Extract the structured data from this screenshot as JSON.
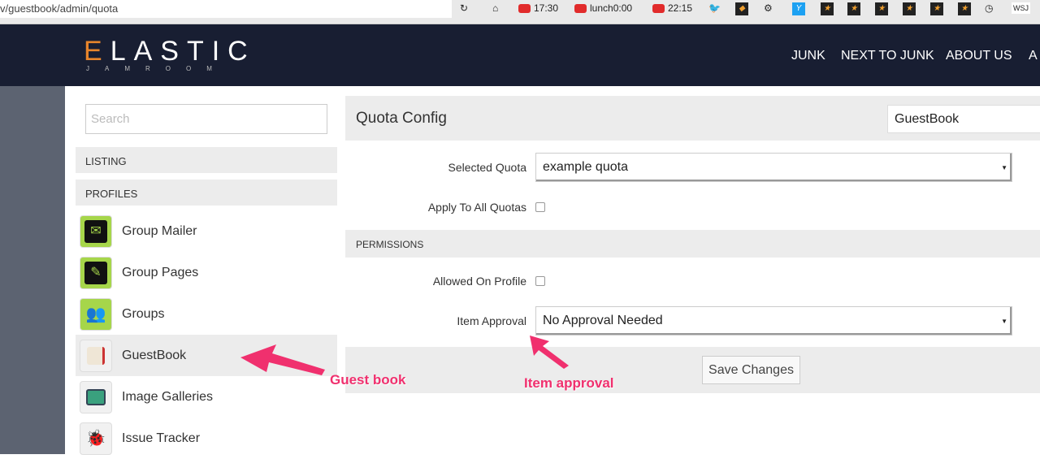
{
  "browser": {
    "url": "v/guestbook/admin/quota",
    "bookmarks": [
      "17:30",
      "lunch0:00",
      "22:15"
    ],
    "wsj": "WSJ"
  },
  "header": {
    "logo_first": "E",
    "logo_rest": "LASTIC",
    "logo_sub": "JAMROOM",
    "nav": [
      "JUNK",
      "NEXT TO JUNK",
      "ABOUT US",
      "A"
    ]
  },
  "sidebar": {
    "search_placeholder": "Search",
    "sections": [
      "LISTING",
      "PROFILES"
    ],
    "items": [
      {
        "label": "Group Mailer",
        "icon": "envelope-icon"
      },
      {
        "label": "Group Pages",
        "icon": "pencil-icon"
      },
      {
        "label": "Groups",
        "icon": "users-icon"
      },
      {
        "label": "GuestBook",
        "icon": "book-icon"
      },
      {
        "label": "Image Galleries",
        "icon": "image-icon"
      },
      {
        "label": "Issue Tracker",
        "icon": "bug-icon"
      }
    ]
  },
  "main": {
    "title": "Quota Config",
    "module_select": "GuestBook",
    "selected_quota_label": "Selected Quota",
    "selected_quota_value": "example quota",
    "apply_all_label": "Apply To All Quotas",
    "permissions": "PERMISSIONS",
    "allowed_label": "Allowed On Profile",
    "approval_label": "Item Approval",
    "approval_value": "No Approval Needed",
    "save": "Save Changes"
  },
  "annotations": {
    "guestbook": "Guest book",
    "approval": "Item approval"
  },
  "colors": {
    "header": "#181e32",
    "accent": "#e8852b",
    "annotation": "#f0306e",
    "icon_green": "#a6d64a"
  }
}
